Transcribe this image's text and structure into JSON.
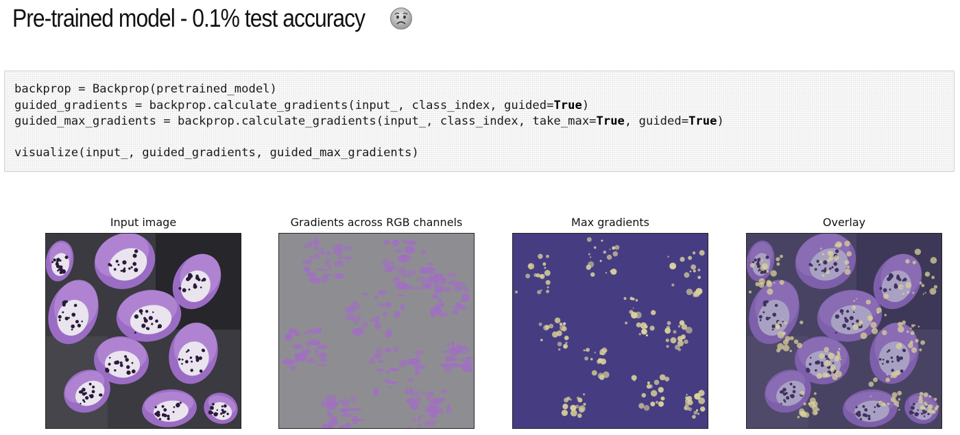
{
  "heading": {
    "text": "Pre-trained model - 0.1% test accuracy",
    "emoji_icon": "anxious-face-icon"
  },
  "code_cell": {
    "lines": [
      [
        {
          "t": "backprop = Backprop(pretrained_model)"
        }
      ],
      [
        {
          "t": "guided_gradients = backprop.calculate_gradients(input_, class_index, guided="
        },
        {
          "t": "True",
          "kw": true
        },
        {
          "t": ")"
        }
      ],
      [
        {
          "t": "guided_max_gradients = backprop.calculate_gradients(input_, class_index, take_max="
        },
        {
          "t": "True",
          "kw": true
        },
        {
          "t": ", guided="
        },
        {
          "t": "True",
          "kw": true
        },
        {
          "t": ")"
        }
      ],
      [
        {
          "t": ""
        }
      ],
      [
        {
          "t": "visualize(input_, guided_gradients, guided_max_gradients)"
        }
      ]
    ]
  },
  "panels": [
    {
      "title": "Input image",
      "image": "foxglove-flower-photo"
    },
    {
      "title": "Gradients across RGB channels",
      "image": "rgb-gradients-map"
    },
    {
      "title": "Max gradients",
      "image": "max-gradients-map"
    },
    {
      "title": "Overlay",
      "image": "overlay-map"
    }
  ],
  "colors": {
    "purple_petal": "#9b6cc4",
    "gradient_gray": "#8e8e92",
    "gradient_magenta": "#a070c0",
    "max_bg": "#463c82",
    "max_spot": "#d8d09a",
    "overlay_tint": "#5a4f8e"
  }
}
